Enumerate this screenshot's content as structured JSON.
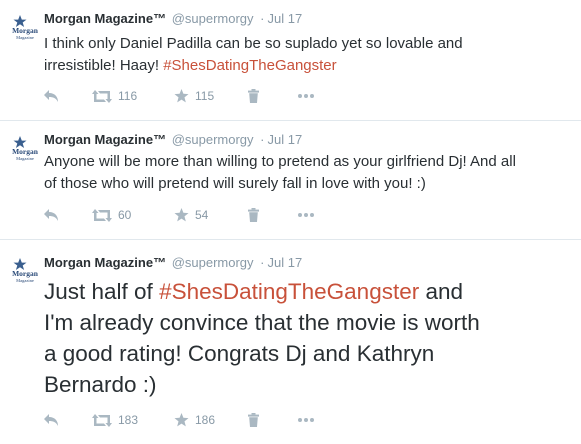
{
  "tweets": [
    {
      "fullname": "Morgan Magazine™",
      "username": "@supermorgy",
      "separator": "·",
      "time": "Jul 17",
      "text_plain": "I think only Daniel Padilla can be so suplado yet so lovable and",
      "text_line2_plain": "irresistible! Haay! ",
      "hashtag": "#ShesDatingTheGangster",
      "retweets": "116",
      "favorites": "115"
    },
    {
      "fullname": "Morgan Magazine™",
      "username": "@supermorgy",
      "separator": "·",
      "time": "Jul 17",
      "text_line1": "Anyone will be more than willing to pretend as your girlfriend Dj! And all",
      "text_line2": "of those who will pretend will surely fall in love with you! :)",
      "retweets": "60",
      "favorites": "54"
    },
    {
      "fullname": "Morgan Magazine™",
      "username": "@supermorgy",
      "separator": "·",
      "time": "Jul 17",
      "text_line1_pre": "Just half of ",
      "hashtag": "#ShesDatingTheGangster",
      "text_line1_post": " and",
      "text_line2": "I'm already convince that the movie is worth",
      "text_line3": "a good rating! Congrats Dj and Kathryn",
      "text_line4": "Bernardo :)",
      "retweets": "183",
      "favorites": "186"
    }
  ],
  "avatar_caption": "Morgan Magazine",
  "icons": {
    "reply": "reply-icon",
    "retweet": "retweet-icon",
    "favorite": "star-icon",
    "delete": "trash-icon",
    "more": "more-icon"
  },
  "colors": {
    "hashtag": "#c8513a",
    "meta": "#8899a6",
    "icon": "#aab8c2",
    "text": "#292f33"
  }
}
